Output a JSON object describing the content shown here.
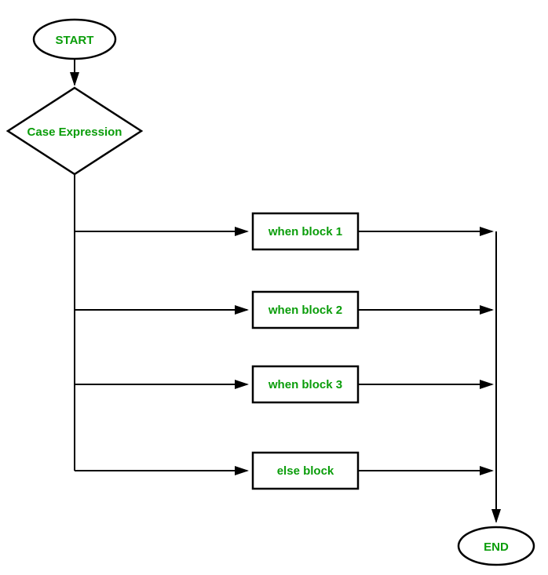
{
  "flowchart": {
    "start": "START",
    "decision": "Case Expression",
    "blocks": [
      "when block 1",
      "when block 2",
      "when block 3",
      "else block"
    ],
    "end": "END"
  }
}
